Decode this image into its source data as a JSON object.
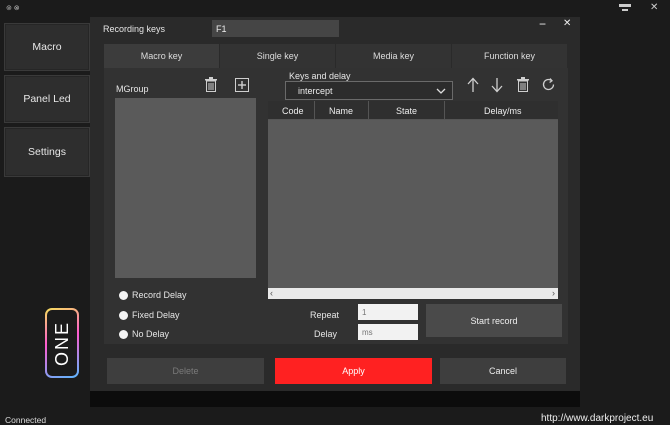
{
  "titlebar": {
    "app_badge": "⊚ ⊗",
    "tray_icon": "display-icon",
    "minimize": "−",
    "close": "✕"
  },
  "sidebar": {
    "items": [
      {
        "label": "Macro"
      },
      {
        "label": "Panel Led"
      },
      {
        "label": "Settings"
      }
    ]
  },
  "logo": {
    "text": "ONE"
  },
  "recording": {
    "label": "Recording keys",
    "value": "F1"
  },
  "tabs": [
    {
      "label": "Macro key"
    },
    {
      "label": "Single key"
    },
    {
      "label": "Media key"
    },
    {
      "label": "Function key"
    }
  ],
  "mgroup": {
    "label": "MGroup"
  },
  "keys_delay": {
    "label": "Keys and delay",
    "selected": "intercept"
  },
  "table": {
    "headers": [
      "Code",
      "Name",
      "State",
      "Delay/ms"
    ]
  },
  "delay_options": [
    {
      "label": "Record Delay"
    },
    {
      "label": "Fixed Delay"
    },
    {
      "label": "No Delay"
    }
  ],
  "repeat": {
    "label": "Repeat",
    "placeholder": "1"
  },
  "delay": {
    "label": "Delay",
    "placeholder": "ms"
  },
  "buttons": {
    "start_record": "Start record",
    "delete": "Delete",
    "apply": "Apply",
    "cancel": "Cancel"
  },
  "status": {
    "connected": "Connected",
    "url": "http://www.darkproject.eu"
  },
  "colors": {
    "apply": "#ff2121",
    "panel": "#323232",
    "list": "#5a5a5a"
  }
}
